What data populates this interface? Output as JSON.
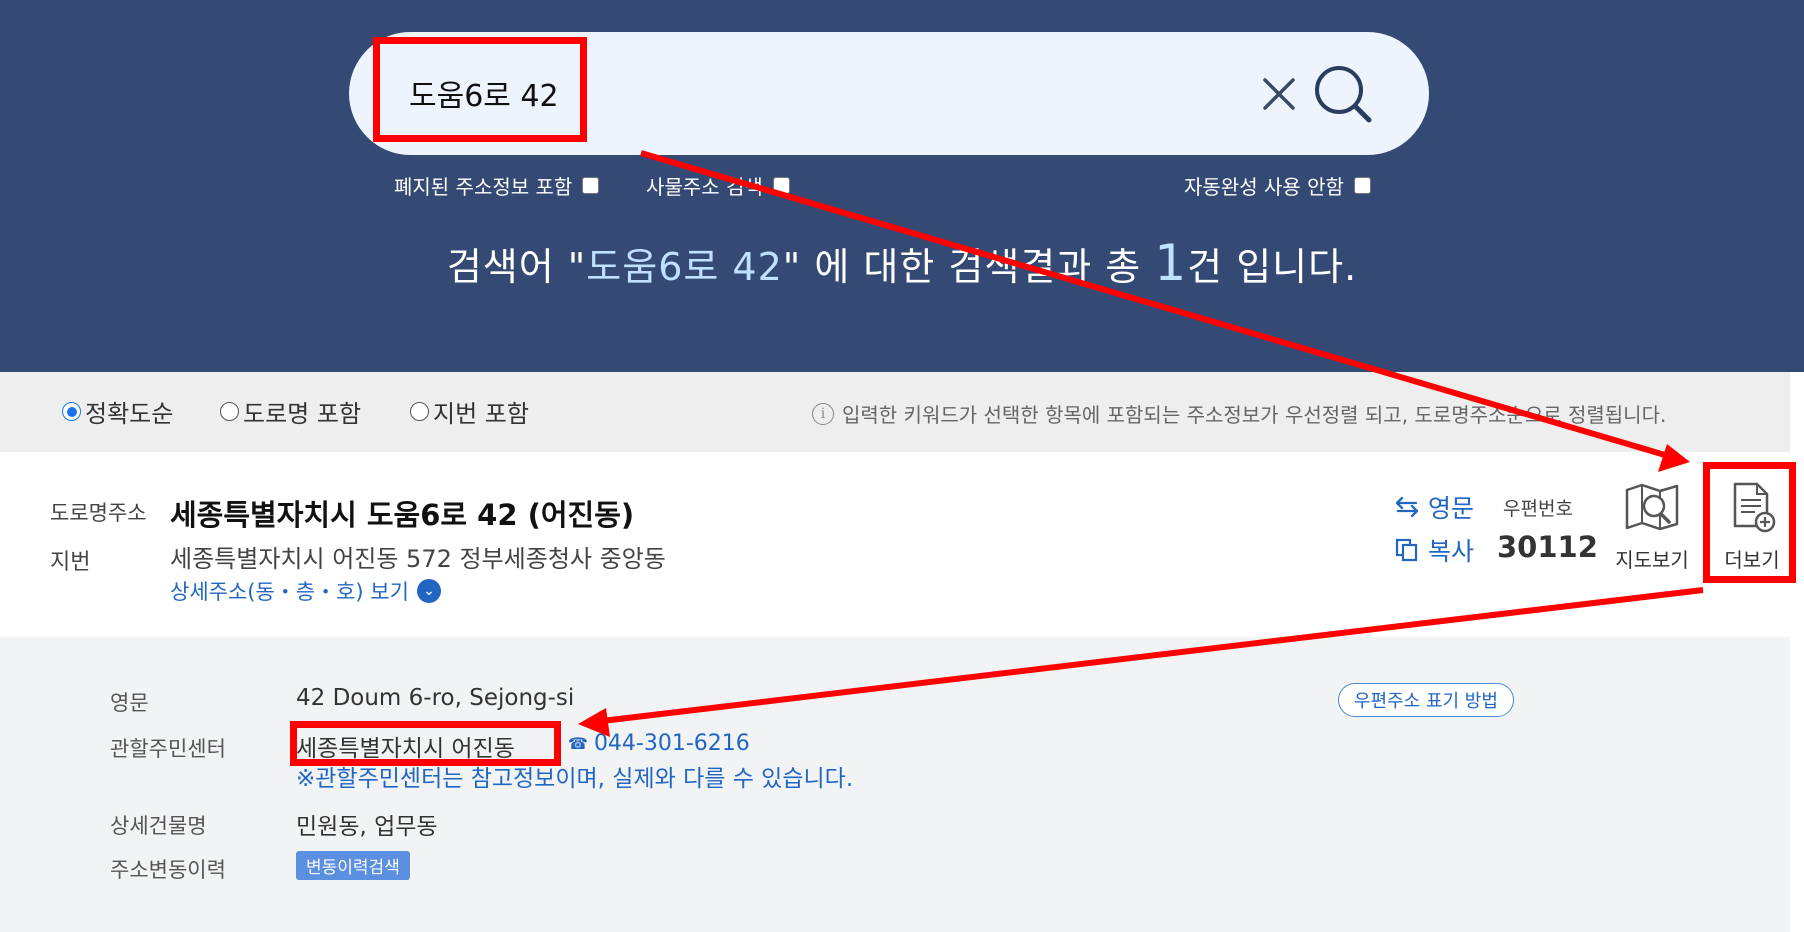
{
  "search": {
    "value": "도움6로 42",
    "options": {
      "abolished": "폐지된 주소정보 포함",
      "object_addr": "사물주소 검색",
      "no_autocomplete": "자동완성 사용 안함"
    },
    "result_prefix": "검색어 \"",
    "result_keyword": "도움6로 42",
    "result_mid": "\" 에 대한 검색결과 총 ",
    "result_count": "1",
    "result_suffix": "건 입니다."
  },
  "sort": {
    "options": [
      "정확도순",
      "도로명 포함",
      "지번 포함"
    ],
    "selected": "정확도순",
    "note": "입력한 키워드가 선택한 항목에 포함되는 주소정보가 우선정렬 되고, 도로명주소순으로 정렬됩니다."
  },
  "result": {
    "road_label": "도로명주소",
    "road_address": "세종특별자치시 도움6로 42 (어진동)",
    "jibun_label": "지번",
    "jibun_address": "세종특별자치시 어진동 572 정부세종청사 중앙동",
    "detail_link": "상세주소(동・층・호) 보기",
    "english_btn": "영문",
    "copy_btn": "복사",
    "zip_label": "우편번호",
    "zip_code": "30112",
    "map_btn": "지도보기",
    "more_btn": "더보기"
  },
  "detail": {
    "english_label": "영문",
    "english_value": "42 Doum 6-ro, Sejong-si",
    "zip_guide_btn": "우편주소 표기 방법",
    "center_label": "관할주민센터",
    "center_value": "세종특별자치시 어진동",
    "center_phone": "044-301-6216",
    "center_notice": "※관할주민센터는 참고정보이며, 실제와 다를 수 있습니다.",
    "building_label": "상세건물명",
    "building_value": "민원동, 업무동",
    "history_label": "주소변동이력",
    "history_btn": "변동이력검색"
  },
  "colors": {
    "header_bg": "#344a74",
    "accent_blue": "#2266c4",
    "annotation_red": "#ff0000"
  }
}
